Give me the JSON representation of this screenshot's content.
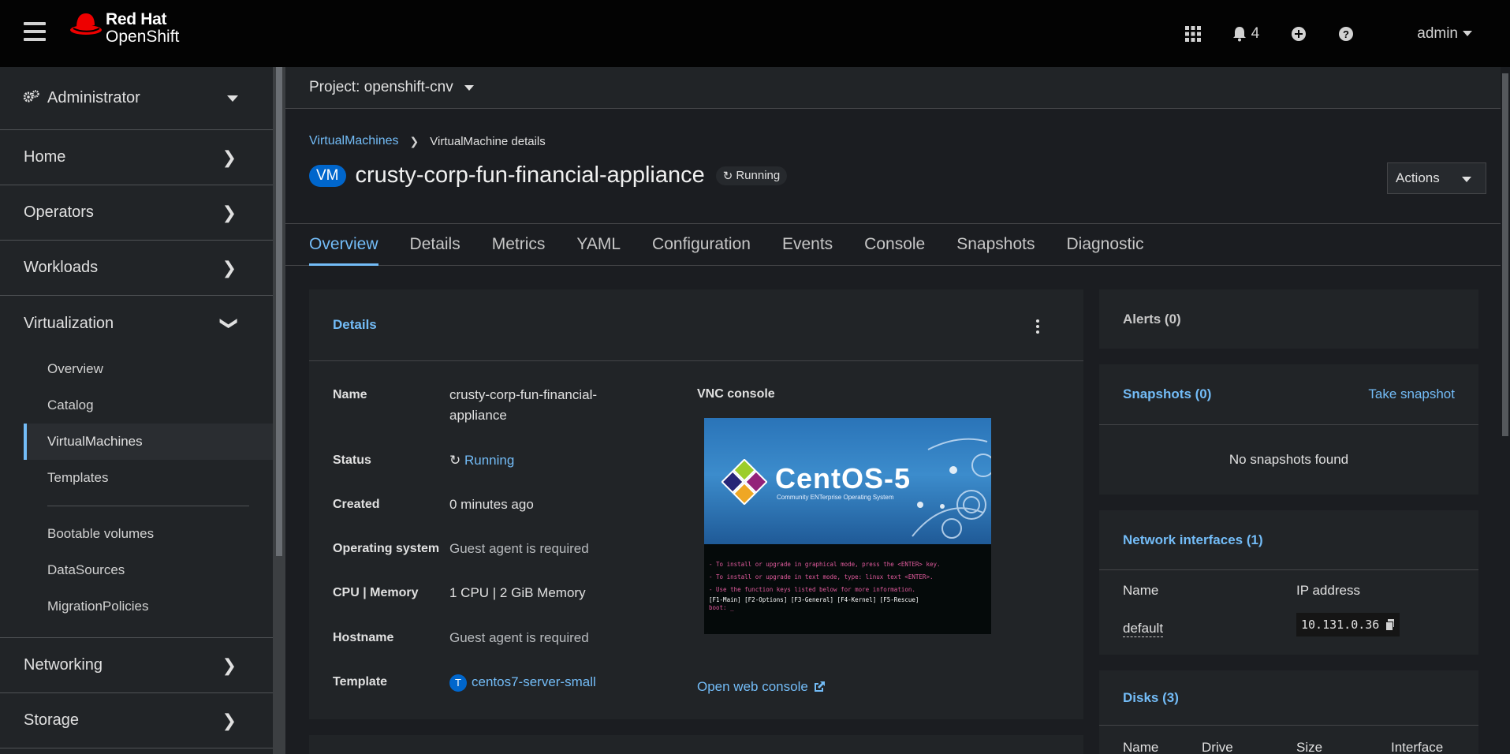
{
  "masthead": {
    "brand_line1": "Red Hat",
    "brand_line2": "OpenShift",
    "notifications_count": "4",
    "user": "admin"
  },
  "sidebar": {
    "perspective": "Administrator",
    "sections": [
      "Home",
      "Operators",
      "Workloads"
    ],
    "expanded": {
      "label": "Virtualization",
      "items": [
        "Overview",
        "Catalog",
        "VirtualMachines",
        "Templates"
      ],
      "items2": [
        "Bootable volumes",
        "DataSources",
        "MigrationPolicies"
      ],
      "active": "VirtualMachines"
    },
    "sections_after": [
      "Networking",
      "Storage"
    ]
  },
  "project": {
    "label": "Project: openshift-cnv"
  },
  "breadcrumb": {
    "parent": "VirtualMachines",
    "current": "VirtualMachine details"
  },
  "header": {
    "badge": "VM",
    "title": "crusty-corp-fun-financial-appliance",
    "status": "Running",
    "actions_label": "Actions"
  },
  "tabs": [
    "Overview",
    "Details",
    "Metrics",
    "YAML",
    "Configuration",
    "Events",
    "Console",
    "Snapshots",
    "Diagnostic"
  ],
  "active_tab": "Overview",
  "details": {
    "title": "Details",
    "rows": [
      {
        "k": "Name",
        "v": "crusty-corp-fun-financial-appliance"
      },
      {
        "k": "Status",
        "v": "Running"
      },
      {
        "k": "Created",
        "v": "0 minutes ago"
      },
      {
        "k": "Operating system",
        "v": "Guest agent is required"
      },
      {
        "k": "CPU | Memory",
        "v": "1 CPU | 2 GiB Memory"
      },
      {
        "k": "Hostname",
        "v": "Guest agent is required"
      },
      {
        "k": "Template",
        "v": "centos7-server-small"
      }
    ],
    "template_badge": "T",
    "vnc_label": "VNC console",
    "open_console": "Open web console",
    "vnc_screen": {
      "brand": "CentOS-5",
      "sub": "Community ENTerprise Operating System",
      "lines": [
        "-  To install or upgrade in graphical mode, press the <ENTER> key.",
        "-  To install or upgrade in text mode, type: linux text <ENTER>.",
        "-  Use the function keys listed below for more information.",
        "[F1-Main] [F2-Options] [F3-General] [F4-Kernel] [F5-Rescue]",
        "boot: _"
      ]
    }
  },
  "alerts": {
    "title": "Alerts (0)"
  },
  "snapshots": {
    "title": "Snapshots (0)",
    "action": "Take snapshot",
    "empty": "No snapshots found"
  },
  "network": {
    "title": "Network interfaces (1)",
    "col_name": "Name",
    "col_ip": "IP address",
    "iface": "default",
    "ip": "10.131.0.36"
  },
  "disks": {
    "title": "Disks (3)",
    "cols": [
      "Name",
      "Drive",
      "Size",
      "Interface"
    ]
  },
  "colors": {
    "accent": "#73bcf7",
    "brand": "#ee0000",
    "badge": "#0066cc"
  }
}
